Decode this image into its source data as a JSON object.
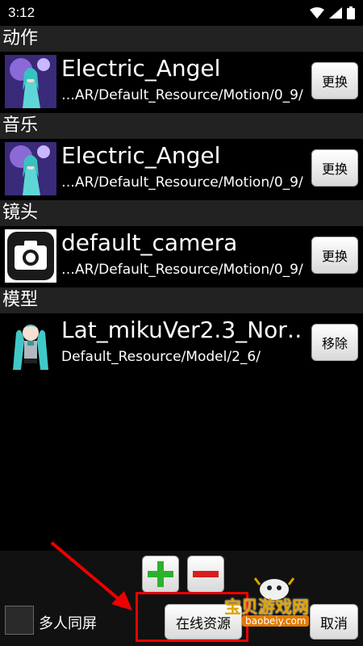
{
  "status": {
    "time": "3:12"
  },
  "sections": [
    {
      "header": "动作",
      "title": "Electric_Angel",
      "path": "…AR/Default_Resource/Motion/0_9/",
      "button": "更换"
    },
    {
      "header": "音乐",
      "title": "Electric_Angel",
      "path": "…AR/Default_Resource/Motion/0_9/",
      "button": "更换"
    },
    {
      "header": "镜头",
      "title": "default_camera",
      "path": "…AR/Default_Resource/Motion/0_9/",
      "button": "更换"
    },
    {
      "header": "模型",
      "title": "Lat_mikuVer2.3_Nor…",
      "path": "Default_Resource/Model/2_6/",
      "button": "移除"
    }
  ],
  "bottom": {
    "multi_label": "多人同屏",
    "online_label": "在线资源",
    "cancel_label": "取消"
  },
  "watermark": {
    "text": "宝贝游戏网",
    "url": "baobeiy.com"
  },
  "colors": {
    "accent_green": "#2bb22b",
    "accent_red": "#d81e1e",
    "highlight": "#e00000"
  }
}
